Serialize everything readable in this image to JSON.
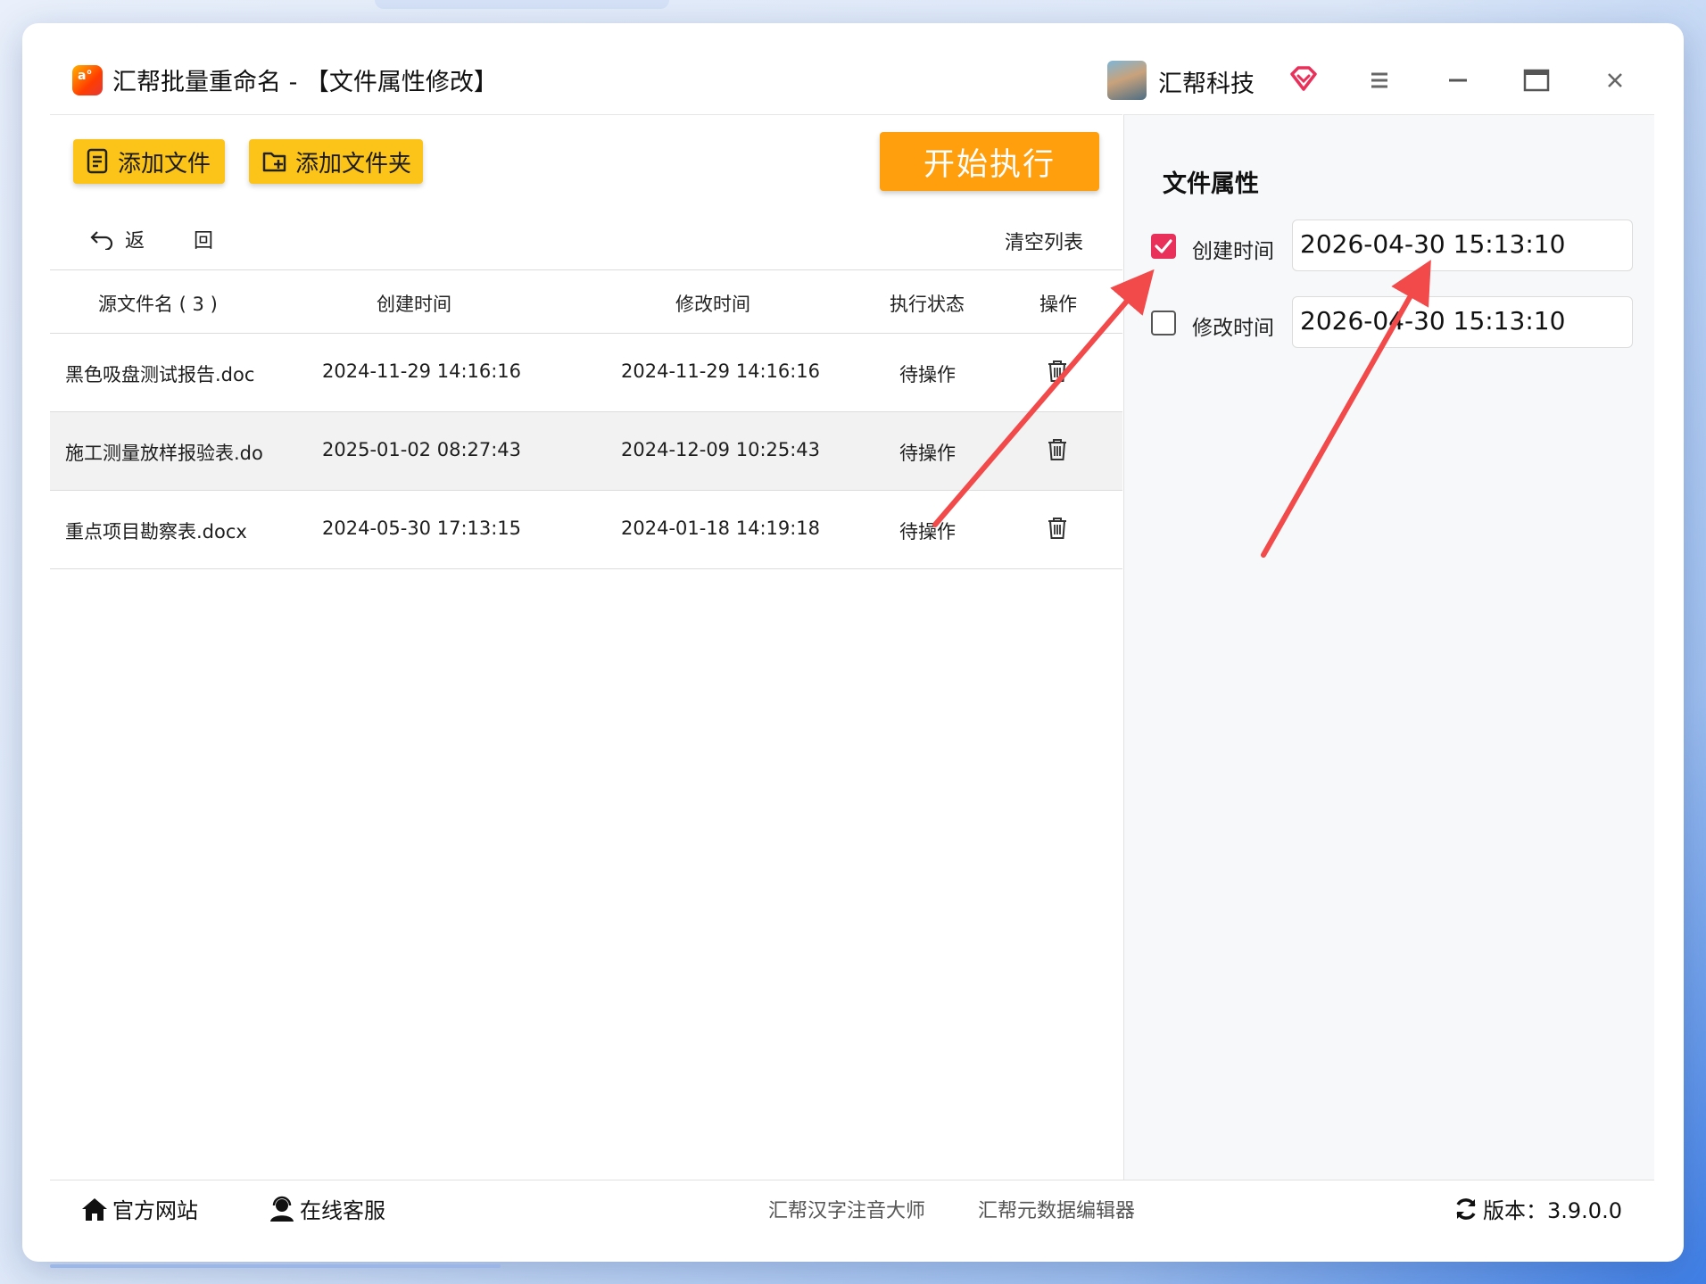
{
  "window": {
    "app_title": "汇帮批量重命名 - 【文件属性修改】",
    "brand": "汇帮科技"
  },
  "toolbar": {
    "add_file": "添加文件",
    "add_folder": "添加文件夹",
    "start": "开始执行",
    "back": "返 回",
    "clear": "清空列表"
  },
  "table": {
    "headers": [
      "源文件名 ( 3 )",
      "创建时间",
      "修改时间",
      "执行状态",
      "操作"
    ],
    "rows": [
      {
        "name": "黑色吸盘测试报告.doc",
        "ctime": "2024-11-29 14:16:16",
        "mtime": "2024-11-29 14:16:16",
        "status": "待操作"
      },
      {
        "name": "施工测量放样报验表.do",
        "ctime": "2025-01-02 08:27:43",
        "mtime": "2024-12-09 10:25:43",
        "status": "待操作"
      },
      {
        "name": "重点项目勘察表.docx",
        "ctime": "2024-05-30 17:13:15",
        "mtime": "2024-01-18 14:19:18",
        "status": "待操作"
      }
    ]
  },
  "panel": {
    "title": "文件属性",
    "create_label": "创建时间",
    "create_value": "2026-04-30 15:13:10",
    "create_checked": true,
    "modify_label": "修改时间",
    "modify_value": "2026-04-30 15:13:10",
    "modify_checked": false
  },
  "footer": {
    "website": "官方网站",
    "support": "在线客服",
    "link1": "汇帮汉字注音大师",
    "link2": "汇帮元数据编辑器",
    "version": "版本：3.9.0.0"
  },
  "colors": {
    "accent_yellow": "#fcc418",
    "start_orange": "#ff9f0d",
    "check_red": "#e8305a",
    "annotation_arrow": "#f24a4a"
  }
}
